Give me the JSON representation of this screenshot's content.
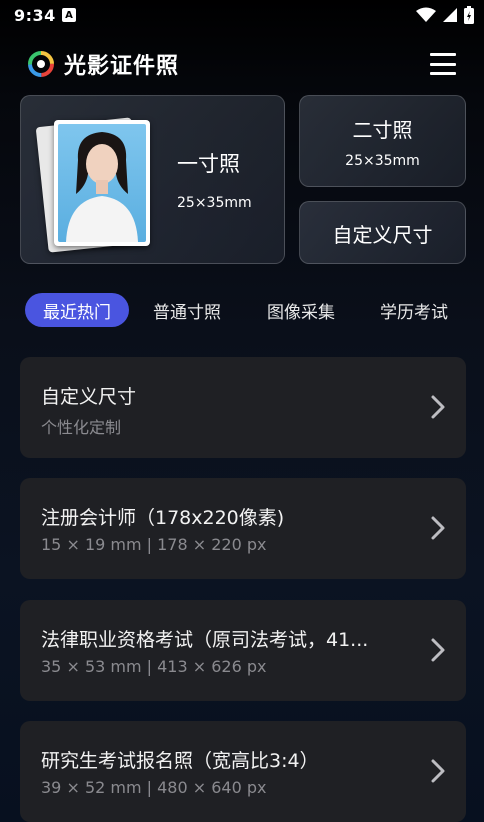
{
  "status_bar": {
    "time": "9:34",
    "notification_letter": "A"
  },
  "header": {
    "app_title": "光影证件照",
    "menu_icon": "hamburger-menu-icon",
    "logo_icon": "aperture-logo-icon"
  },
  "cards": {
    "one_inch": {
      "title": "一寸照",
      "size": "25×35mm"
    },
    "two_inch": {
      "title": "二寸照",
      "size": "25×35mm"
    },
    "custom": {
      "title": "自定义尺寸"
    }
  },
  "tabs": [
    {
      "label": "最近热门",
      "active": true
    },
    {
      "label": "普通寸照",
      "active": false
    },
    {
      "label": "图像采集",
      "active": false
    },
    {
      "label": "学历考试",
      "active": false
    }
  ],
  "items": [
    {
      "title": "自定义尺寸",
      "subtitle": "个性化定制"
    },
    {
      "title": "注册会计师（178x220像素)",
      "subtitle": "15 × 19 mm | 178 × 220 px"
    },
    {
      "title": "法律职业资格考试（原司法考试，41...",
      "subtitle": "35 × 53 mm | 413 × 626 px"
    },
    {
      "title": "研究生考试报名照（宽高比3:4）",
      "subtitle": "39 × 52 mm | 480 × 640 px"
    }
  ],
  "colors": {
    "accent": "#4a55e0",
    "item_bg": "#1f2024",
    "subtitle": "#8a8a8f"
  }
}
